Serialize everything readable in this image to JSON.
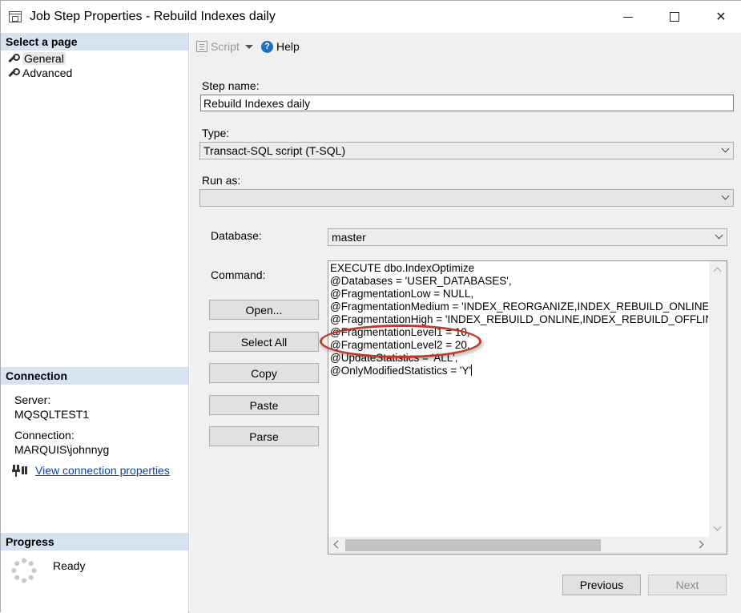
{
  "window": {
    "title": "Job Step Properties - Rebuild Indexes daily",
    "controls": {
      "minimize": "",
      "maximize": "",
      "close": "✕"
    }
  },
  "left_pane": {
    "select_page_header": "Select a page",
    "pages": [
      {
        "label": "General",
        "icon": "wrench-icon"
      },
      {
        "label": "Advanced",
        "icon": "wrench-icon"
      }
    ],
    "connection": {
      "header": "Connection",
      "server_label": "Server:",
      "server_value": "MQSQLTEST1",
      "connection_label": "Connection:",
      "connection_value": "MARQUIS\\johnnyg",
      "link_text": "View connection properties"
    },
    "progress": {
      "header": "Progress",
      "status": "Ready"
    }
  },
  "toolbar": {
    "script_label": "Script",
    "help_label": "Help"
  },
  "form": {
    "step_name_label": "Step name:",
    "step_name_value": "Rebuild Indexes daily",
    "type_label": "Type:",
    "type_value": "Transact-SQL script (T-SQL)",
    "run_as_label": "Run as:",
    "run_as_value": "",
    "database_label": "Database:",
    "database_value": "master",
    "command_label": "Command:",
    "command_lines": [
      "EXECUTE dbo.IndexOptimize",
      "@Databases = 'USER_DATABASES',",
      "@FragmentationLow = NULL,",
      "@FragmentationMedium = 'INDEX_REORGANIZE,INDEX_REBUILD_ONLINE,INDEX_REBUILD_OFFLINE',",
      "@FragmentationHigh = 'INDEX_REBUILD_ONLINE,INDEX_REBUILD_OFFLINE',",
      "@FragmentationLevel1 = 10,",
      "@FragmentationLevel2 = 20,",
      "@UpdateStatistics = 'ALL',",
      "@OnlyModifiedStatistics = 'Y'"
    ],
    "buttons": {
      "open": "Open...",
      "select_all": "Select All",
      "copy": "Copy",
      "paste": "Paste",
      "parse": "Parse"
    }
  },
  "footer": {
    "previous": "Previous",
    "next": "Next"
  },
  "colors": {
    "section_header_bg": "#d7e3f0",
    "link": "#0645ad",
    "annotation": "#c0392b",
    "editor_border": "#569de5"
  }
}
